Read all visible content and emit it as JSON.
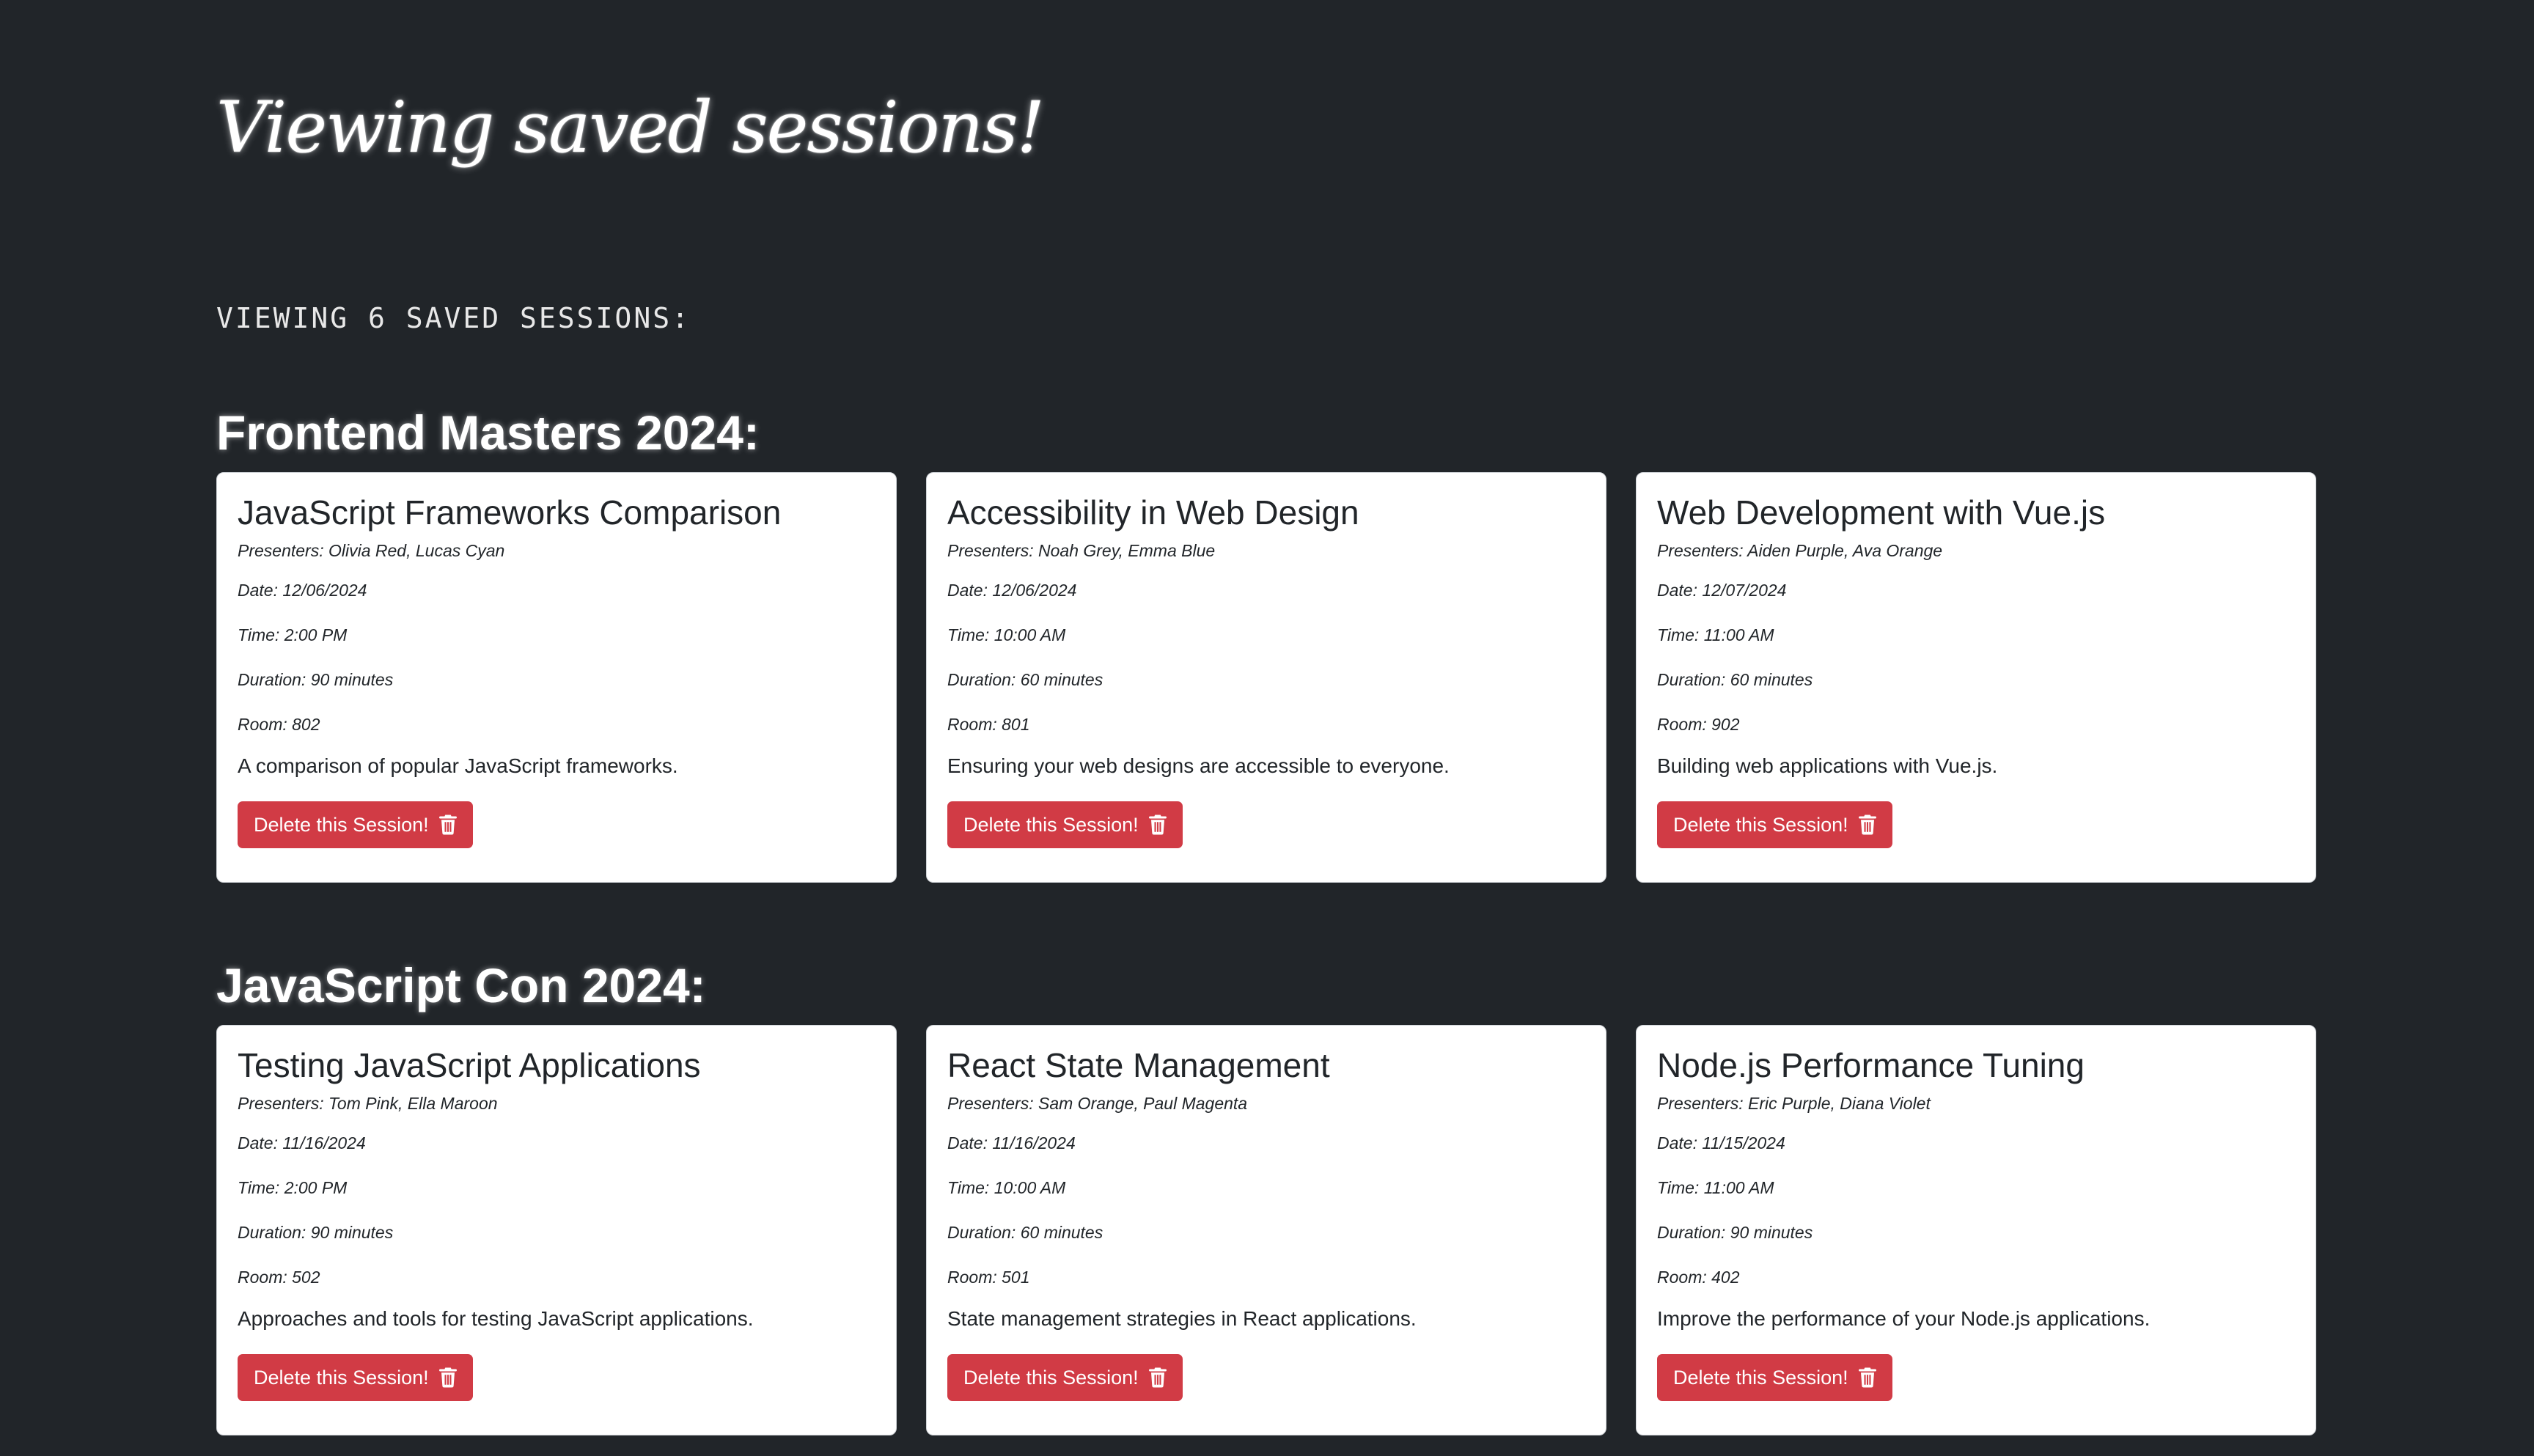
{
  "page": {
    "title": "Viewing saved sessions!",
    "saved_count_text": "Viewing 6 saved sessions:"
  },
  "colors": {
    "background": "#212529",
    "card_background": "#ffffff",
    "delete_button": "#d13b45"
  },
  "conferences": [
    {
      "heading": "Frontend Masters 2024:",
      "sessions": [
        {
          "title": "JavaScript Frameworks Comparison",
          "presenters": "Presenters: Olivia Red, Lucas Cyan",
          "date": "Date: 12/06/2024",
          "time": "Time: 2:00 PM",
          "duration": "Duration: 90 minutes",
          "room": "Room: 802",
          "description": "A comparison of popular JavaScript frameworks.",
          "delete_label": "Delete this Session!",
          "delete_icon": "trash-icon"
        },
        {
          "title": "Accessibility in Web Design",
          "presenters": "Presenters: Noah Grey, Emma Blue",
          "date": "Date: 12/06/2024",
          "time": "Time: 10:00 AM",
          "duration": "Duration: 60 minutes",
          "room": "Room: 801",
          "description": "Ensuring your web designs are accessible to everyone.",
          "delete_label": "Delete this Session!",
          "delete_icon": "trash-icon"
        },
        {
          "title": "Web Development with Vue.js",
          "presenters": "Presenters: Aiden Purple, Ava Orange",
          "date": "Date: 12/07/2024",
          "time": "Time: 11:00 AM",
          "duration": "Duration: 60 minutes",
          "room": "Room: 902",
          "description": "Building web applications with Vue.js.",
          "delete_label": "Delete this Session!",
          "delete_icon": "trash-icon"
        }
      ]
    },
    {
      "heading": "JavaScript Con 2024:",
      "sessions": [
        {
          "title": "Testing JavaScript Applications",
          "presenters": "Presenters: Tom Pink, Ella Maroon",
          "date": "Date: 11/16/2024",
          "time": "Time: 2:00 PM",
          "duration": "Duration: 90 minutes",
          "room": "Room: 502",
          "description": "Approaches and tools for testing JavaScript applications.",
          "delete_label": "Delete this Session!",
          "delete_icon": "trash-icon"
        },
        {
          "title": "React State Management",
          "presenters": "Presenters: Sam Orange, Paul Magenta",
          "date": "Date: 11/16/2024",
          "time": "Time: 10:00 AM",
          "duration": "Duration: 60 minutes",
          "room": "Room: 501",
          "description": "State management strategies in React applications.",
          "delete_label": "Delete this Session!",
          "delete_icon": "trash-icon"
        },
        {
          "title": "Node.js Performance Tuning",
          "presenters": "Presenters: Eric Purple, Diana Violet",
          "date": "Date: 11/15/2024",
          "time": "Time: 11:00 AM",
          "duration": "Duration: 90 minutes",
          "room": "Room: 402",
          "description": "Improve the performance of your Node.js applications.",
          "delete_label": "Delete this Session!",
          "delete_icon": "trash-icon"
        }
      ]
    }
  ]
}
